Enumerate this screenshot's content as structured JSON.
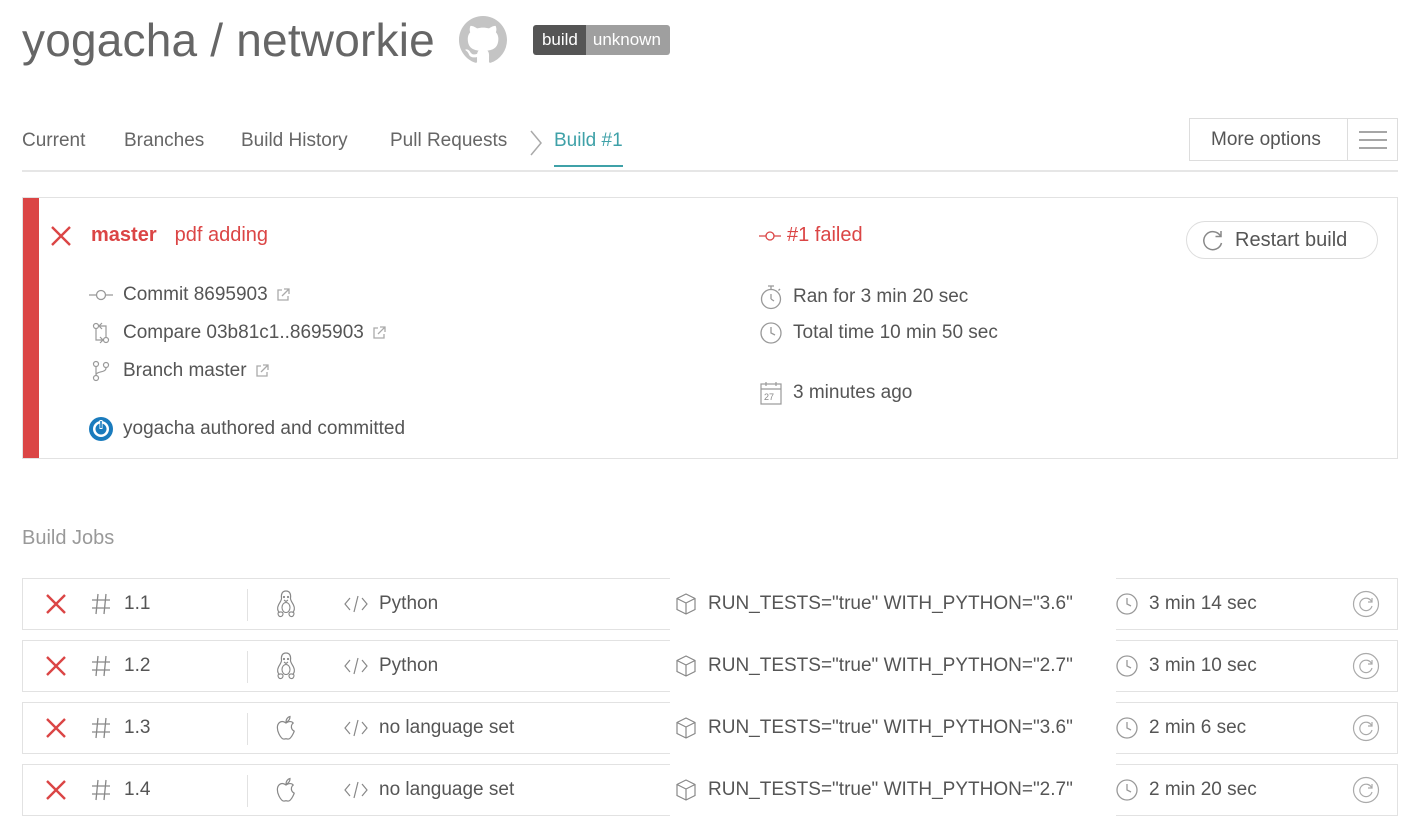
{
  "repo": {
    "title": "yogacha / networkie"
  },
  "badge": {
    "left": "build",
    "right": "unknown"
  },
  "tabs": [
    {
      "label": "Current"
    },
    {
      "label": "Branches"
    },
    {
      "label": "Build History"
    },
    {
      "label": "Pull Requests"
    },
    {
      "label": "Build #1"
    }
  ],
  "more_options": {
    "label": "More options"
  },
  "build": {
    "branch": "master",
    "message": "pdf adding",
    "status": "#1 failed",
    "commit": "Commit 8695903",
    "compare": "Compare 03b81c1..8695903",
    "branch_link": "Branch master",
    "author": "yogacha authored and committed",
    "ran_for": "Ran for 3 min 20 sec",
    "total_time": "Total time 10 min 50 sec",
    "when": "3 minutes ago",
    "calendar_day": "27",
    "restart_label": "Restart build"
  },
  "jobs_title": "Build Jobs",
  "jobs": [
    {
      "number": "1.1",
      "os": "linux-icon",
      "language": "Python",
      "env": "RUN_TESTS=\"true\" WITH_PYTHON=\"3.6\"",
      "duration": "3 min 14 sec"
    },
    {
      "number": "1.2",
      "os": "linux-icon",
      "language": "Python",
      "env": "RUN_TESTS=\"true\" WITH_PYTHON=\"2.7\"",
      "duration": "3 min 10 sec"
    },
    {
      "number": "1.3",
      "os": "apple-icon",
      "language": "no language set",
      "env": "RUN_TESTS=\"true\" WITH_PYTHON=\"3.6\"",
      "duration": "2 min 6 sec"
    },
    {
      "number": "1.4",
      "os": "apple-icon",
      "language": "no language set",
      "env": "RUN_TESTS=\"true\" WITH_PYTHON=\"2.7\"",
      "duration": "2 min 20 sec"
    }
  ],
  "colors": {
    "failed": "#db4545",
    "accent": "#3fa1a8",
    "badge_dark": "#555555",
    "badge_light": "#9f9f9f"
  }
}
